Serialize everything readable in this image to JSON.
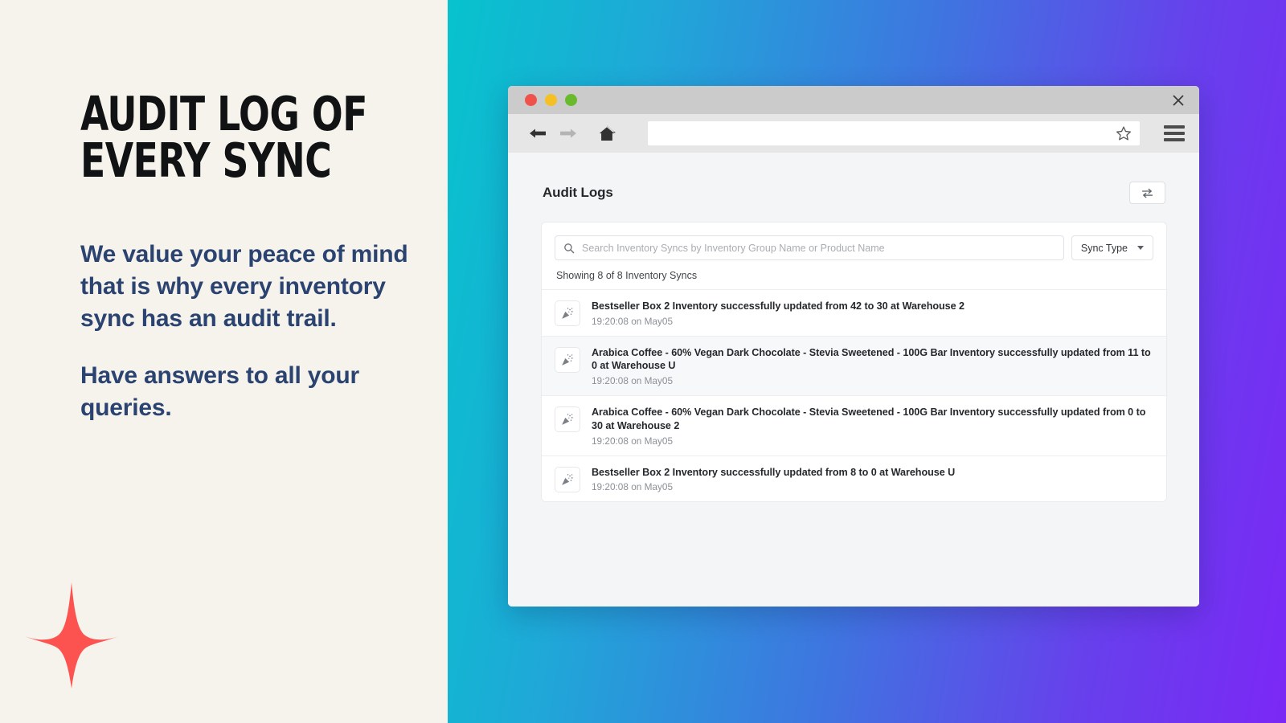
{
  "marketing": {
    "headline_line1": "Audit log of",
    "headline_line2": "Every Sync",
    "paragraph1": "We value your peace of mind that is why every inventory sync has an audit trail.",
    "paragraph2": "Have answers to all your  queries.",
    "sparkle_icon": "four-point-sparkle-icon",
    "colors": {
      "background": "#f6f3ec",
      "headline": "#111213",
      "body_text": "#2b4370",
      "sparkle": "#fc5350",
      "gradient_start": "#07c3cd",
      "gradient_end": "#7b28f5"
    }
  },
  "browser": {
    "traffic_lights": [
      "close-red",
      "minimize-yellow",
      "maximize-green"
    ],
    "close_icon": "close-icon",
    "back_icon": "arrow-left-icon",
    "forward_icon": "arrow-right-icon",
    "home_icon": "home-icon",
    "bookmark_icon": "star-outline-icon",
    "menu_icon": "hamburger-menu-icon",
    "address_value": "",
    "address_placeholder": ""
  },
  "app": {
    "page_title": "Audit Logs",
    "sync_button_icon": "swap-arrows-icon",
    "search": {
      "icon": "search-icon",
      "value": "",
      "placeholder": "Search Inventory Syncs by Inventory Group Name or Product Name"
    },
    "sync_type_filter": {
      "label": "Sync Type",
      "caret_icon": "chevron-down-icon"
    },
    "result_count": "Showing 8 of 8 Inventory Syncs",
    "logs": [
      {
        "icon": "party-popper-icon",
        "message": "Bestseller Box 2 Inventory successfully updated from 42 to 30 at Warehouse 2",
        "timestamp": "19:20:08 on May05"
      },
      {
        "icon": "party-popper-icon",
        "message": "Arabica Coffee - 60% Vegan Dark Chocolate - Stevia Sweetened - 100G Bar Inventory successfully updated from 11 to 0 at Warehouse U",
        "timestamp": "19:20:08 on May05"
      },
      {
        "icon": "party-popper-icon",
        "message": "Arabica Coffee - 60% Vegan Dark Chocolate - Stevia Sweetened - 100G Bar Inventory successfully updated from 0 to 30 at Warehouse 2",
        "timestamp": "19:20:08 on May05"
      },
      {
        "icon": "party-popper-icon",
        "message": "Bestseller Box 2 Inventory successfully updated from 8 to 0 at Warehouse U",
        "timestamp": "19:20:08 on May05"
      }
    ]
  }
}
